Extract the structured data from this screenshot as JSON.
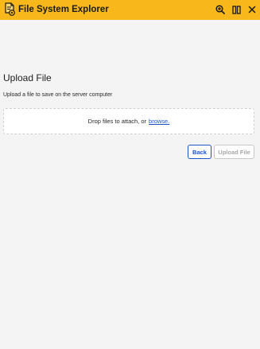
{
  "titlebar": {
    "app_title": "File System Explorer",
    "icons": [
      "app-folder-icon",
      "zoom-icon",
      "columns-icon",
      "close-icon"
    ],
    "background": "#f8b81b"
  },
  "page": {
    "title": "Upload File",
    "subtitle": "Upload a file to save on the server computer"
  },
  "dropzone": {
    "text": "Drop files to attach, or",
    "browse_label": "browse."
  },
  "actions": {
    "back_label": "Back",
    "upload_label": "Upload File",
    "upload_disabled": true
  },
  "colors": {
    "accent": "#1a56c9",
    "background": "#f4f4f4",
    "disabled_text": "#a8a8a8"
  }
}
